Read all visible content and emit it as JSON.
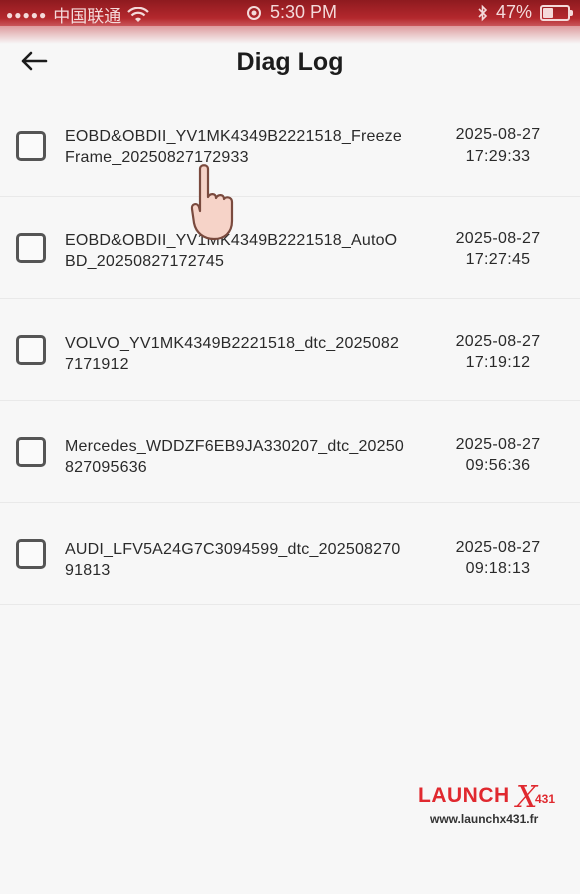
{
  "status_bar": {
    "carrier": "中国联通",
    "time": "5:30 PM",
    "battery": "47%",
    "battery_level": 0.47,
    "icons": [
      "signal-icon",
      "wifi-icon",
      "location-icon",
      "bluetooth-icon",
      "battery-icon"
    ]
  },
  "header": {
    "title": "Diag Log",
    "back_icon": "arrow-left-icon"
  },
  "logs": [
    {
      "name": "EOBD&OBDII_YV1MK4349B2221518_FreezeFrame_20250827172933",
      "date": "2025-08-27",
      "time": "17:29:33",
      "checked": false
    },
    {
      "name": "EOBD&OBDII_YV1MK4349B2221518_AutoOBD_20250827172745",
      "date": "2025-08-27",
      "time": "17:27:45",
      "checked": false
    },
    {
      "name": "VOLVO_YV1MK4349B2221518_dtc_20250827171912",
      "date": "2025-08-27",
      "time": "17:19:12",
      "checked": false
    },
    {
      "name": "Mercedes_WDDZF6EB9JA330207_dtc_20250827095636",
      "date": "2025-08-27",
      "time": "09:56:36",
      "checked": false
    },
    {
      "name": "AUDI_LFV5A24G7C3094599_dtc_20250827091813",
      "date": "2025-08-27",
      "time": "09:18:13",
      "checked": false
    }
  ],
  "watermark": {
    "brand": "LAUNCH",
    "brand_x": "X",
    "brand_num": "431",
    "url": "www.launchx431.fr"
  },
  "colors": {
    "status_bar": "#b4282d",
    "brand_red": "#e0292f",
    "background": "#f7f7f7"
  }
}
